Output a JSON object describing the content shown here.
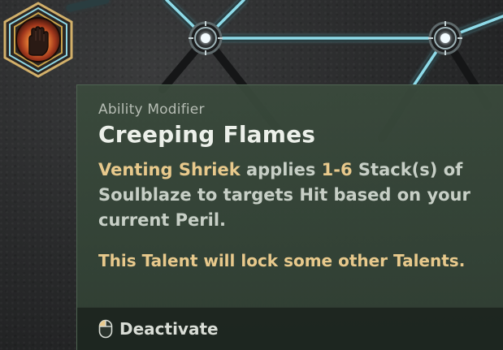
{
  "tooltip": {
    "category": "Ability Modifier",
    "title": "Creeping Flames",
    "description": {
      "ability": "Venting Shriek",
      "applies": " applies ",
      "amount": "1-6",
      "rest_line1": " Stack(s) of",
      "rest": "Soulblaze to targets Hit based on your current Peril."
    },
    "lock_note": "This Talent will lock some other Talents.",
    "action": {
      "icon": "mouse-left-click-icon",
      "label": "Deactivate"
    }
  },
  "talent_node": {
    "icon": "burning-hand-icon"
  },
  "colors": {
    "highlight": "#e8c98c",
    "tooltip_bg": "#3a4a3c",
    "link_glow": "#7ad4e6",
    "talent_frame": "#c9a24a"
  }
}
